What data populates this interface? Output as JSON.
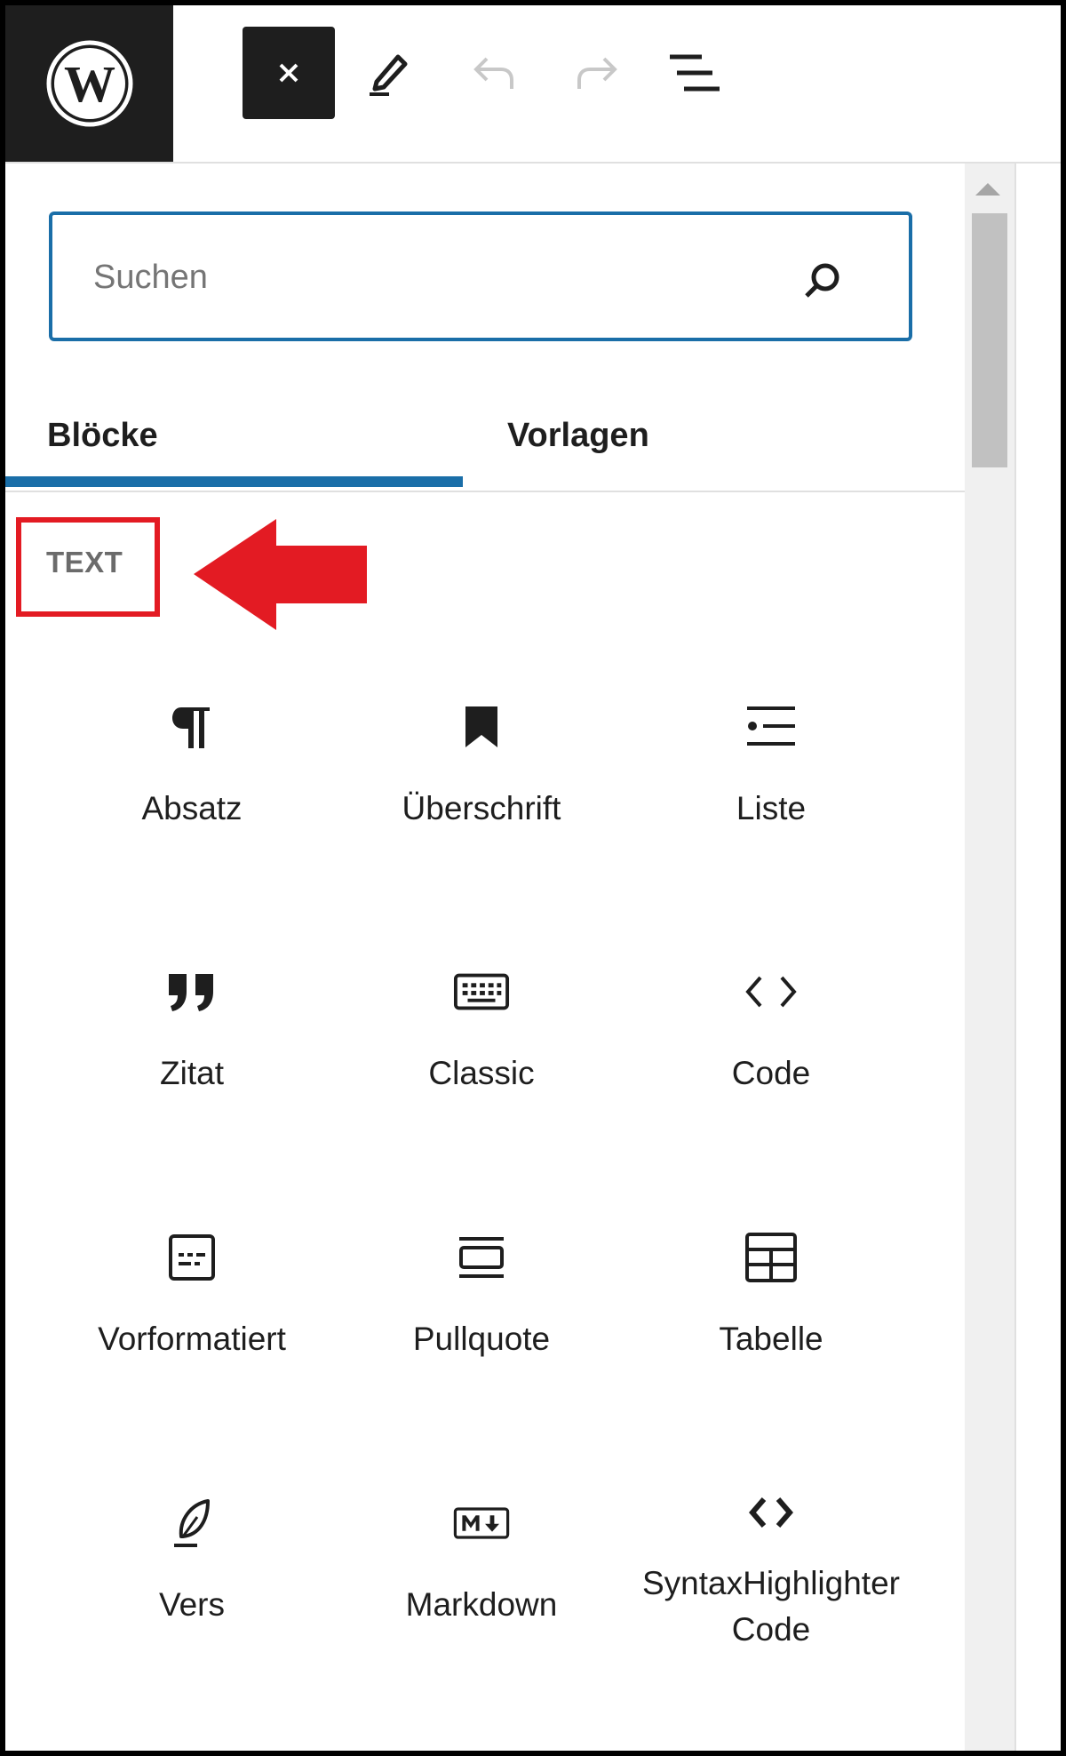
{
  "toolbar": {
    "logo_icon": "wordpress-logo",
    "close_icon": "close-icon",
    "edit_icon": "pencil-icon",
    "undo_icon": "undo-icon",
    "redo_icon": "redo-icon",
    "list_view_icon": "list-view-icon"
  },
  "search": {
    "placeholder": "Suchen",
    "value": ""
  },
  "tabs": [
    {
      "label": "Blöcke",
      "active": true
    },
    {
      "label": "Vorlagen",
      "active": false
    }
  ],
  "category": {
    "label": "TEXT",
    "highlight_color": "#e31b23"
  },
  "blocks": [
    {
      "label": "Absatz",
      "icon": "paragraph-icon"
    },
    {
      "label": "Überschrift",
      "icon": "bookmark-icon"
    },
    {
      "label": "Liste",
      "icon": "list-icon"
    },
    {
      "label": "Zitat",
      "icon": "quote-icon"
    },
    {
      "label": "Classic",
      "icon": "keyboard-icon"
    },
    {
      "label": "Code",
      "icon": "code-icon"
    },
    {
      "label": "Vorformatiert",
      "icon": "preformatted-icon"
    },
    {
      "label": "Pullquote",
      "icon": "pullquote-icon"
    },
    {
      "label": "Tabelle",
      "icon": "table-icon"
    },
    {
      "label": "Vers",
      "icon": "feather-icon"
    },
    {
      "label": "Markdown",
      "icon": "markdown-icon"
    },
    {
      "label": "SyntaxHighlighter Code",
      "icon": "code-bold-icon"
    }
  ],
  "colors": {
    "accent": "#1a6ea8",
    "dark": "#1e1e1e",
    "annotation": "#e31b23"
  }
}
